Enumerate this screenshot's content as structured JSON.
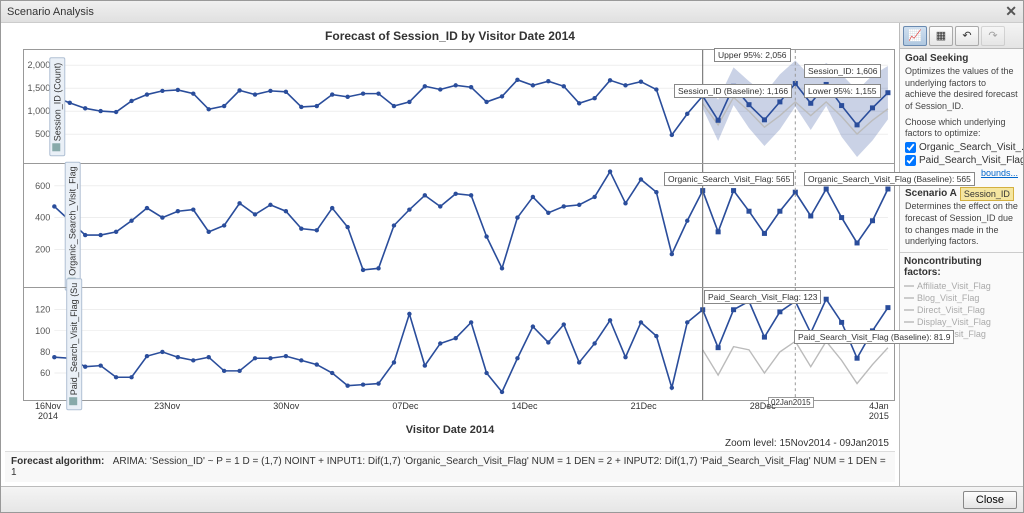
{
  "titlebar": {
    "text": "Scenario Analysis"
  },
  "chart_title": "Forecast of Session_ID by Visitor Date 2014",
  "xaxis_title": "Visitor Date 2014",
  "zoom_text": "Zoom level:  15Nov2014 - 09Jan2015",
  "algo_label": "Forecast algorithm:",
  "algo_text": "ARIMA:  'Session_ID' ~ P = 1  D = (1,7)   NOINT  +  INPUT1: Dif(1,7) 'Organic_Search_Visit_Flag'  NUM = 1  DEN = 2  +  INPUT2: Dif(1,7) 'Paid_Search_Visit_Flag'  NUM = 1  DEN = 1",
  "xticks": [
    "16Nov\n2014",
    "23Nov",
    "30Nov",
    "07Dec",
    "14Dec",
    "21Dec",
    "28Dec",
    "4Jan\n2015"
  ],
  "forecast_date_badge": "02Jan2015",
  "toolbar": {
    "b1": "chart-line-icon",
    "b2": "table-icon",
    "b3": "undo-icon",
    "b4": "redo-icon"
  },
  "side": {
    "goal_h": "Goal Seeking",
    "goal_txt": "Optimizes the values of the underlying factors to achieve the desired forecast of Session_ID.",
    "choose_txt": "Choose which underlying factors to optimize:",
    "chk1": "Organic_Search_Visit_...",
    "chk2": "Paid_Search_Visit_Flag",
    "bounds": "bounds...",
    "scenario_h": "Scenario A",
    "scenario_badge": "Session_ID",
    "scenario_txt": "Determines the effect on the forecast of Session_ID due to changes made in the underlying factors.",
    "nc_h": "Noncontributing factors:",
    "nc_items": [
      "Affiliate_Visit_Flag",
      "Blog_Visit_Flag",
      "Direct_Visit_Flag",
      "Display_Visit_Flag",
      "Social_Visit_Flag"
    ]
  },
  "callouts": {
    "upper95": "Upper 95%: 2,056",
    "session_id": "Session_ID: 1,606",
    "lower95": "Lower 95%: 1,155",
    "session_baseline": "Session_ID (Baseline): 1,166",
    "organic": "Organic_Search_Visit_Flag: 565",
    "organic_baseline": "Organic_Search_Visit_Flag (Baseline): 565",
    "paid": "Paid_Search_Visit_Flag: 123",
    "paid_baseline": "Paid_Search_Visit_Flag (Baseline): 81.9"
  },
  "footer": {
    "close": "Close"
  },
  "chart_data": [
    {
      "type": "line",
      "panel": "Session_ID (Count)",
      "ylabel": "Session_ID (Count)",
      "ylim": [
        0,
        2200
      ],
      "yticks": [
        500,
        1000,
        1500,
        2000
      ],
      "history_end_index": 42,
      "forecast_marker_index": 48,
      "values": [
        1310,
        1180,
        1060,
        1000,
        980,
        1220,
        1360,
        1440,
        1460,
        1380,
        1040,
        1110,
        1450,
        1360,
        1440,
        1420,
        1090,
        1110,
        1360,
        1310,
        1380,
        1380,
        1110,
        1200,
        1540,
        1470,
        1560,
        1520,
        1200,
        1320,
        1680,
        1560,
        1650,
        1540,
        1170,
        1280,
        1670,
        1560,
        1640,
        1470,
        480,
        940,
        1330,
        800,
        1540,
        1140,
        810,
        1200,
        1600,
        1170,
        1580,
        1120,
        700,
        1070,
        1400
      ],
      "upper95": [
        null,
        null,
        null,
        null,
        null,
        null,
        null,
        null,
        null,
        null,
        null,
        null,
        null,
        null,
        null,
        null,
        null,
        null,
        null,
        null,
        null,
        null,
        null,
        null,
        null,
        null,
        null,
        null,
        null,
        null,
        null,
        null,
        null,
        null,
        null,
        null,
        null,
        null,
        null,
        null,
        null,
        null,
        1600,
        1250,
        1950,
        1650,
        1380,
        1800,
        2100,
        1750,
        2050,
        1800,
        1450,
        1780,
        1980
      ],
      "lower95": [
        null,
        null,
        null,
        null,
        null,
        null,
        null,
        null,
        null,
        null,
        null,
        null,
        null,
        null,
        null,
        null,
        null,
        null,
        null,
        null,
        null,
        null,
        null,
        null,
        null,
        null,
        null,
        null,
        null,
        null,
        null,
        null,
        null,
        null,
        null,
        null,
        null,
        null,
        null,
        null,
        null,
        null,
        1060,
        350,
        1130,
        630,
        240,
        600,
        1100,
        590,
        1110,
        440,
        -50,
        360,
        820
      ],
      "baseline": [
        null,
        null,
        null,
        null,
        null,
        null,
        null,
        null,
        null,
        null,
        null,
        null,
        null,
        null,
        null,
        null,
        null,
        null,
        null,
        null,
        null,
        null,
        null,
        null,
        null,
        null,
        null,
        null,
        null,
        null,
        null,
        null,
        null,
        null,
        null,
        null,
        null,
        null,
        null,
        null,
        null,
        null,
        1166,
        700,
        1300,
        1000,
        650,
        900,
        1200,
        900,
        1200,
        880,
        500,
        800,
        1050
      ]
    },
    {
      "type": "line",
      "panel": "Organic_Search_Visit_Flag",
      "ylabel": "Organic_Search_Visit_Flag",
      "ylim": [
        0,
        700
      ],
      "yticks": [
        200,
        400,
        600
      ],
      "values": [
        470,
        380,
        290,
        290,
        310,
        380,
        460,
        400,
        440,
        450,
        310,
        350,
        490,
        420,
        480,
        440,
        330,
        320,
        460,
        340,
        70,
        80,
        350,
        450,
        540,
        470,
        550,
        540,
        280,
        80,
        400,
        530,
        430,
        470,
        480,
        530,
        690,
        490,
        640,
        560,
        170,
        380,
        570,
        310,
        570,
        440,
        300,
        440,
        560,
        410,
        580,
        400,
        240,
        380,
        580
      ],
      "baseline": [
        null,
        null,
        null,
        null,
        null,
        null,
        null,
        null,
        null,
        null,
        null,
        null,
        null,
        null,
        null,
        null,
        null,
        null,
        null,
        null,
        null,
        null,
        null,
        null,
        null,
        null,
        null,
        null,
        null,
        null,
        null,
        null,
        null,
        null,
        null,
        null,
        null,
        null,
        null,
        null,
        null,
        null,
        565,
        310,
        570,
        440,
        300,
        440,
        560,
        410,
        580,
        400,
        240,
        380,
        580
      ]
    },
    {
      "type": "line",
      "panel": "Paid_Search_Visit_Flag (Su",
      "ylabel": "Paid_Search_Visit_Flag (Su",
      "ylim": [
        40,
        135
      ],
      "yticks": [
        60,
        80,
        100,
        120
      ],
      "values": [
        75,
        74,
        66,
        67,
        56,
        56,
        76,
        80,
        75,
        72,
        75,
        62,
        62,
        74,
        74,
        76,
        72,
        68,
        60,
        48,
        49,
        50,
        70,
        116,
        67,
        88,
        93,
        108,
        60,
        42,
        74,
        104,
        89,
        106,
        70,
        88,
        110,
        75,
        108,
        95,
        46,
        108,
        120,
        84,
        120,
        128,
        94,
        118,
        128,
        98,
        130,
        108,
        74,
        100,
        122
      ],
      "baseline": [
        null,
        null,
        null,
        null,
        null,
        null,
        null,
        null,
        null,
        null,
        null,
        null,
        null,
        null,
        null,
        null,
        null,
        null,
        null,
        null,
        null,
        null,
        null,
        null,
        null,
        null,
        null,
        null,
        null,
        null,
        null,
        null,
        null,
        null,
        null,
        null,
        null,
        null,
        null,
        null,
        null,
        null,
        82,
        58,
        85,
        82,
        60,
        80,
        90,
        66,
        90,
        72,
        50,
        68,
        84
      ]
    }
  ]
}
